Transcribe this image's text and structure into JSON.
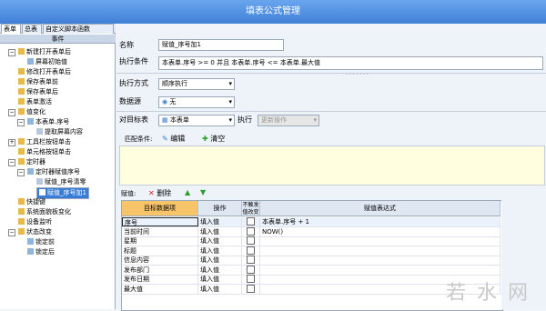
{
  "window": {
    "title": "填表公式管理"
  },
  "tabs": [
    {
      "label": "表单",
      "active": true
    },
    {
      "label": "总表",
      "active": false
    },
    {
      "label": "自定义脚本函数",
      "active": false
    }
  ],
  "left_panel": {
    "header": "事件",
    "items": [
      {
        "label": "新建打开表单后",
        "level": 1,
        "expander": "−"
      },
      {
        "label": "屏幕初始值",
        "level": 2
      },
      {
        "label": "修改打开表单后",
        "level": 1
      },
      {
        "label": "保存表单前",
        "level": 1
      },
      {
        "label": "保存表单后",
        "level": 1
      },
      {
        "label": "表单激活",
        "level": 1
      },
      {
        "label": "值变化",
        "level": 1,
        "expander": "−"
      },
      {
        "label": "本表单.序号",
        "level": 2,
        "expander": "−"
      },
      {
        "label": "提取屏幕内容",
        "level": 3
      },
      {
        "label": "工具栏按钮单击",
        "level": 1,
        "expander": "+"
      },
      {
        "label": "单元格按钮单击",
        "level": 1
      },
      {
        "label": "定时器",
        "level": 1,
        "expander": "−"
      },
      {
        "label": "定时器赋值序号",
        "level": 2,
        "expander": "−"
      },
      {
        "label": "赋值_序号清零",
        "level": 3
      },
      {
        "label": "赋值_序号加1",
        "level": 3,
        "selected": true
      },
      {
        "label": "快捷键",
        "level": 1
      },
      {
        "label": "系统面貌板变化",
        "level": 1
      },
      {
        "label": "设备监听",
        "level": 1
      },
      {
        "label": "状态改变",
        "level": 1,
        "expander": "−"
      },
      {
        "label": "锁定前",
        "level": 2
      },
      {
        "label": "锁定后",
        "level": 2
      }
    ]
  },
  "form": {
    "name_label": "名称",
    "name_value": "赋值_序号加1",
    "cond_label": "执行条件",
    "cond_value": "本表单.序号  >= 0 并且  本表单.序号   <=   本表单.最大值",
    "exec_mode_label": "执行方式",
    "exec_mode_value": "顺序执行",
    "datasource_label": "数据源",
    "datasource_value": "无",
    "target_label": "对目标表",
    "target_value": "本表单",
    "execute_label": "执行",
    "execute_value": "更新操作",
    "match_label": "匹配条件:",
    "edit_label": "编辑",
    "clear_label": "清空",
    "assign_label": "赋值:",
    "delete_label": "删除"
  },
  "grid": {
    "headers": [
      "目标数据项",
      "操作",
      "不触发值改变",
      "赋值表达式"
    ],
    "rows": [
      {
        "target": "序号",
        "op": "填入值",
        "no_trigger": false,
        "expr": "本表单.序号  + 1"
      },
      {
        "target": "当前时间",
        "op": "填入值",
        "no_trigger": false,
        "expr": "NOW()"
      },
      {
        "target": "星期",
        "op": "填入值",
        "no_trigger": false,
        "expr": ""
      },
      {
        "target": "标题",
        "op": "填入值",
        "no_trigger": false,
        "expr": ""
      },
      {
        "target": "信息内容",
        "op": "填入值",
        "no_trigger": false,
        "expr": ""
      },
      {
        "target": "发布部门",
        "op": "填入值",
        "no_trigger": false,
        "expr": ""
      },
      {
        "target": "发布日期",
        "op": "填入值",
        "no_trigger": false,
        "expr": ""
      },
      {
        "target": "最大值",
        "op": "填入值",
        "no_trigger": false,
        "expr": ""
      }
    ]
  },
  "watermark": "若水网",
  "colors": {
    "title_bar": "#3f7fd6",
    "selection": "#3a7bd5",
    "panel": "#eef3fa"
  }
}
